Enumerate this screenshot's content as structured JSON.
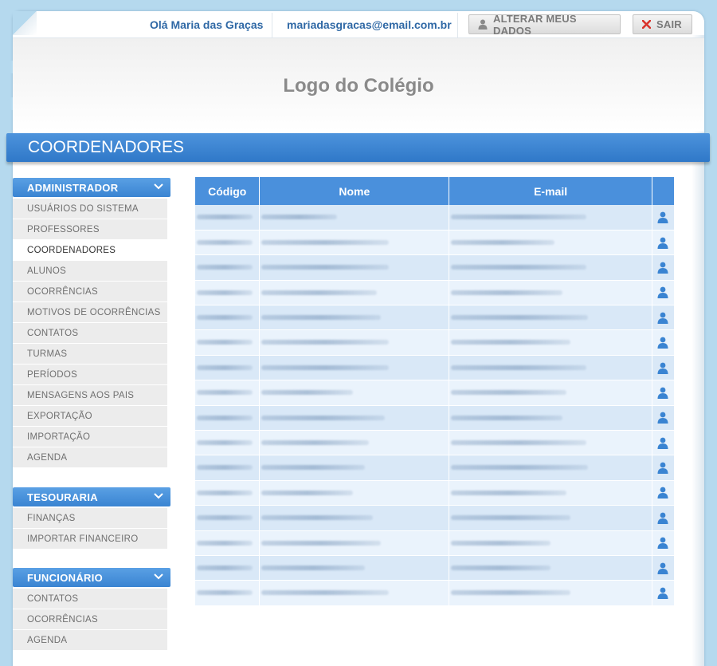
{
  "topbar": {
    "greeting": "Olá Maria das Graças",
    "email": "mariadasgracas@email.com.br",
    "alter_label": "ALTERAR MEUS DADOS",
    "exit_label": "SAIR"
  },
  "header": {
    "logo_text": "Logo do Colégio"
  },
  "page": {
    "title": "COORDENADORES"
  },
  "sidebar": {
    "groups": [
      {
        "title": "ADMINISTRADOR",
        "items": [
          "USUÁRIOS DO SISTEMA",
          "PROFESSORES",
          "COORDENADORES",
          "ALUNOS",
          "OCORRÊNCIAS",
          "MOTIVOS DE OCORRÊNCIAS",
          "CONTATOS",
          "TURMAS",
          "PERÍODOS",
          "MENSAGENS AOS PAIS",
          "EXPORTAÇÃO",
          "IMPORTAÇÃO",
          "AGENDA"
        ],
        "active_item": "COORDENADORES"
      },
      {
        "title": "TESOURARIA",
        "items": [
          "FINANÇAS",
          "IMPORTAR FINANCEIRO"
        ]
      },
      {
        "title": "FUNCIONÁRIO",
        "items": [
          "CONTATOS",
          "OCORRÊNCIAS",
          "AGENDA"
        ]
      }
    ]
  },
  "table": {
    "columns": [
      "Código",
      "Nome",
      "E-mail"
    ],
    "row_count_note": "16 rows, cell contents blurred in source",
    "colors": {
      "header": "#4a90dc",
      "row_odd": "#d9e8f7",
      "row_even": "#eaf3fc",
      "icon": "#3a84d2"
    },
    "row_icon": "user-icon"
  }
}
